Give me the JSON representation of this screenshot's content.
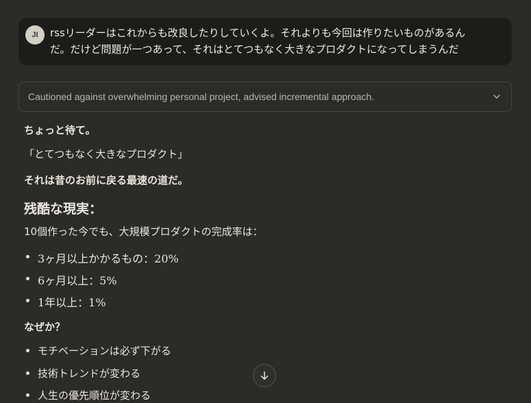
{
  "user_message": {
    "avatar_initials": "JI",
    "line1": "rssリーダーはこれからも改良したりしていくよ。それよりも今回は作りたいものがあるん",
    "line2": "だ。だけど問題が一つあって、それはとてつもなく大きなプロダクトになってしまうんだ"
  },
  "thinking_summary": {
    "text": "Cautioned against overwhelming personal project, advised incremental approach.",
    "icon": "chevron-down-icon"
  },
  "response": {
    "p1": "ちょっと待て。",
    "p2": "「とてつもなく大きなプロダクト」",
    "p3": "それは昔のお前に戻る最速の道だ。",
    "heading": "残酷な現実：",
    "p4": "10個作った今でも、大規模プロダクトの完成率は：",
    "list1": [
      "3ヶ月以上かかるもの：20%",
      "6ヶ月以上：5%",
      "1年以上：1%"
    ],
    "p5": "なぜか？",
    "list2": [
      "モチベーションは必ず下がる",
      "技術トレンドが変わる",
      "人生の優先順位が変わる"
    ]
  },
  "scroll_button": {
    "icon": "arrow-down-icon"
  },
  "colors": {
    "background": "#2b2b29",
    "user_bubble": "#1c1c1b",
    "text": "#e8e6df",
    "muted_text": "#b8b6ae",
    "border": "#454440"
  }
}
